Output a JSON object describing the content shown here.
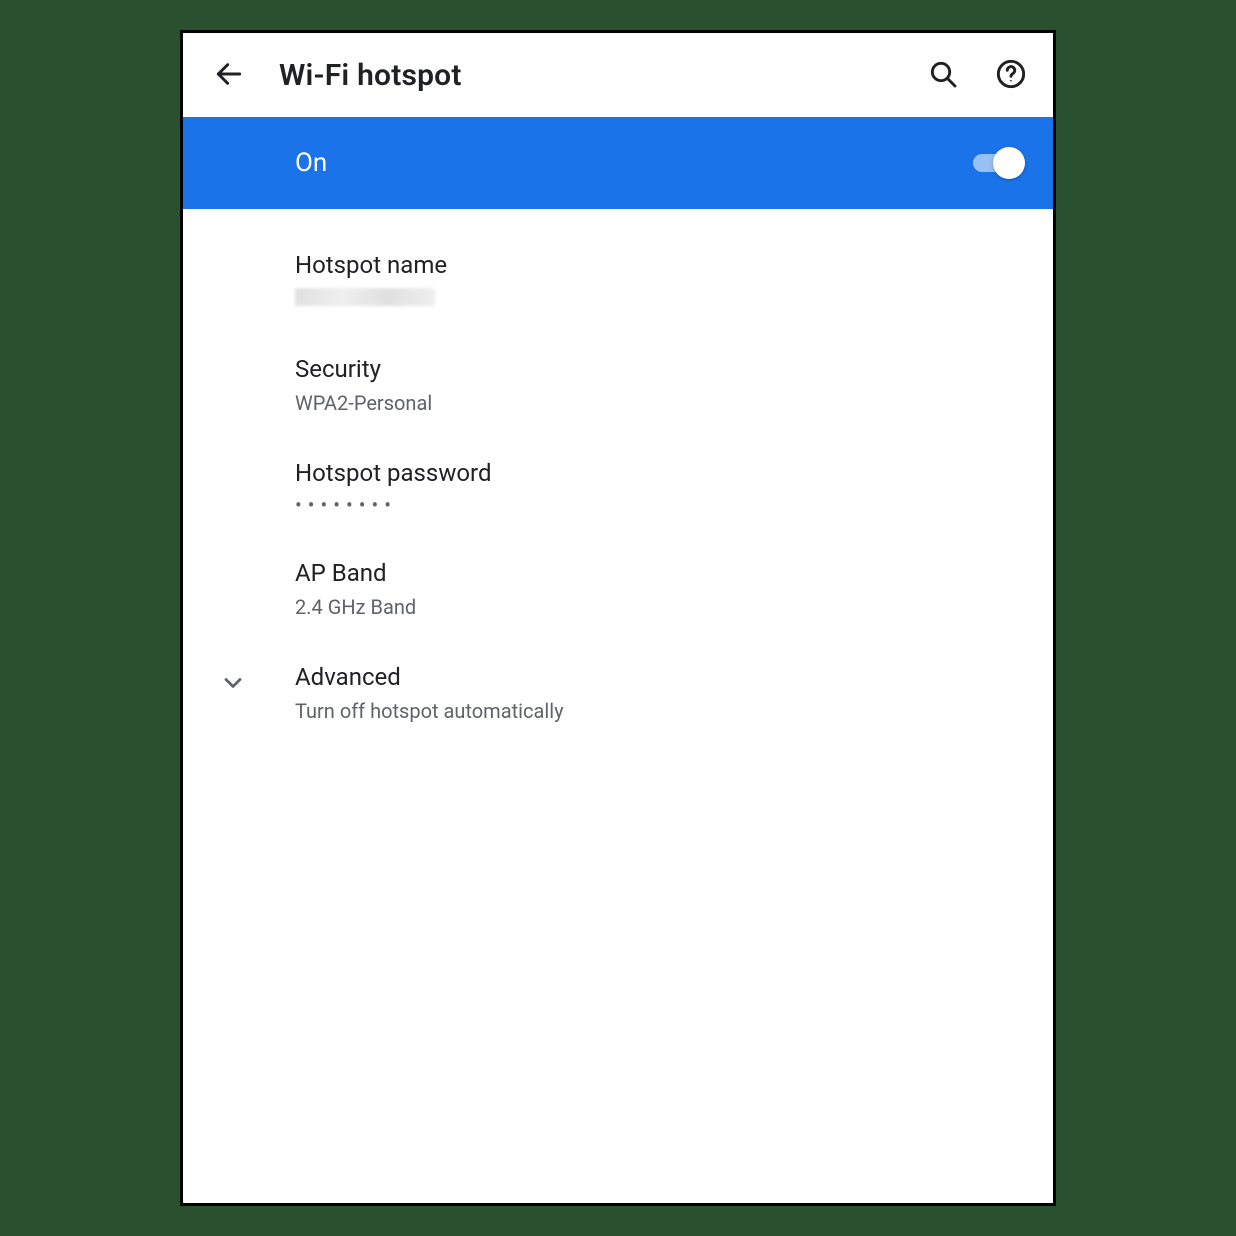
{
  "header": {
    "title": "Wi-Fi hotspot"
  },
  "toggle": {
    "label": "On",
    "state": true
  },
  "settings": {
    "hotspot_name": {
      "label": "Hotspot name",
      "value_redacted": true
    },
    "security": {
      "label": "Security",
      "value": "WPA2-Personal"
    },
    "password": {
      "label": "Hotspot password",
      "value_masked": "••••••••"
    },
    "ap_band": {
      "label": "AP Band",
      "value": "2.4 GHz Band"
    },
    "advanced": {
      "label": "Advanced",
      "value": "Turn off hotspot automatically"
    }
  }
}
